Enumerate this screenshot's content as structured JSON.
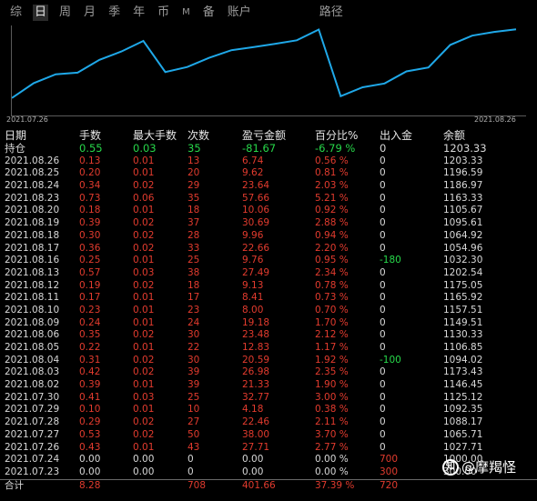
{
  "tabs": [
    {
      "label": "综",
      "active": false
    },
    {
      "label": "日",
      "active": true
    },
    {
      "label": "周",
      "active": false
    },
    {
      "label": "月",
      "active": false
    },
    {
      "label": "季",
      "active": false
    },
    {
      "label": "年",
      "active": false
    },
    {
      "label": "币",
      "active": false
    },
    {
      "label": "M",
      "active": false
    },
    {
      "label": "备",
      "active": false
    },
    {
      "label": "账户",
      "active": false
    },
    {
      "label": "路径",
      "active": false
    }
  ],
  "chart": {
    "start_date": "2021.07.26",
    "end_date": "2021.08.26",
    "line_color": "#1fa8e8"
  },
  "headers": [
    "日期",
    "手数",
    "最大手数",
    "次数",
    "盈亏金额",
    "百分比%",
    "出入金",
    "余额"
  ],
  "holding": {
    "label": "持仓",
    "lots": "0.55",
    "max_lots": "0.03",
    "count": "35",
    "pnl": "-81.67",
    "pct": "-6.79 %",
    "flow": "0",
    "balance": "1203.33"
  },
  "rows": [
    {
      "date": "2021.08.26",
      "lots": "0.13",
      "max": "0.01",
      "count": "13",
      "pnl": "6.74",
      "pct": "0.56 %",
      "flow": "0",
      "balance": "1203.33",
      "flow_color": "white"
    },
    {
      "date": "2021.08.25",
      "lots": "0.20",
      "max": "0.01",
      "count": "20",
      "pnl": "9.62",
      "pct": "0.81 %",
      "flow": "0",
      "balance": "1196.59",
      "flow_color": "white"
    },
    {
      "date": "2021.08.24",
      "lots": "0.34",
      "max": "0.02",
      "count": "29",
      "pnl": "23.64",
      "pct": "2.03 %",
      "flow": "0",
      "balance": "1186.97",
      "flow_color": "white"
    },
    {
      "date": "2021.08.23",
      "lots": "0.73",
      "max": "0.06",
      "count": "35",
      "pnl": "57.66",
      "pct": "5.21 %",
      "flow": "0",
      "balance": "1163.33",
      "flow_color": "white"
    },
    {
      "date": "2021.08.20",
      "lots": "0.18",
      "max": "0.01",
      "count": "18",
      "pnl": "10.06",
      "pct": "0.92 %",
      "flow": "0",
      "balance": "1105.67",
      "flow_color": "white"
    },
    {
      "date": "2021.08.19",
      "lots": "0.39",
      "max": "0.02",
      "count": "37",
      "pnl": "30.69",
      "pct": "2.88 %",
      "flow": "0",
      "balance": "1095.61",
      "flow_color": "white"
    },
    {
      "date": "2021.08.18",
      "lots": "0.30",
      "max": "0.02",
      "count": "28",
      "pnl": "9.96",
      "pct": "0.94 %",
      "flow": "0",
      "balance": "1064.92",
      "flow_color": "white"
    },
    {
      "date": "2021.08.17",
      "lots": "0.36",
      "max": "0.02",
      "count": "33",
      "pnl": "22.66",
      "pct": "2.20 %",
      "flow": "0",
      "balance": "1054.96",
      "flow_color": "white"
    },
    {
      "date": "2021.08.16",
      "lots": "0.25",
      "max": "0.01",
      "count": "25",
      "pnl": "9.76",
      "pct": "0.95 %",
      "flow": "-180",
      "balance": "1032.30",
      "flow_color": "green"
    },
    {
      "date": "2021.08.13",
      "lots": "0.57",
      "max": "0.03",
      "count": "38",
      "pnl": "27.49",
      "pct": "2.34 %",
      "flow": "0",
      "balance": "1202.54",
      "flow_color": "white"
    },
    {
      "date": "2021.08.12",
      "lots": "0.19",
      "max": "0.02",
      "count": "18",
      "pnl": "9.13",
      "pct": "0.78 %",
      "flow": "0",
      "balance": "1175.05",
      "flow_color": "white"
    },
    {
      "date": "2021.08.11",
      "lots": "0.17",
      "max": "0.01",
      "count": "17",
      "pnl": "8.41",
      "pct": "0.73 %",
      "flow": "0",
      "balance": "1165.92",
      "flow_color": "white"
    },
    {
      "date": "2021.08.10",
      "lots": "0.23",
      "max": "0.01",
      "count": "23",
      "pnl": "8.00",
      "pct": "0.70 %",
      "flow": "0",
      "balance": "1157.51",
      "flow_color": "white"
    },
    {
      "date": "2021.08.09",
      "lots": "0.24",
      "max": "0.01",
      "count": "24",
      "pnl": "19.18",
      "pct": "1.70 %",
      "flow": "0",
      "balance": "1149.51",
      "flow_color": "white"
    },
    {
      "date": "2021.08.06",
      "lots": "0.35",
      "max": "0.02",
      "count": "30",
      "pnl": "23.48",
      "pct": "2.12 %",
      "flow": "0",
      "balance": "1130.33",
      "flow_color": "white"
    },
    {
      "date": "2021.08.05",
      "lots": "0.22",
      "max": "0.01",
      "count": "22",
      "pnl": "12.83",
      "pct": "1.17 %",
      "flow": "0",
      "balance": "1106.85",
      "flow_color": "white"
    },
    {
      "date": "2021.08.04",
      "lots": "0.31",
      "max": "0.02",
      "count": "30",
      "pnl": "20.59",
      "pct": "1.92 %",
      "flow": "-100",
      "balance": "1094.02",
      "flow_color": "green"
    },
    {
      "date": "2021.08.03",
      "lots": "0.42",
      "max": "0.02",
      "count": "39",
      "pnl": "26.98",
      "pct": "2.35 %",
      "flow": "0",
      "balance": "1173.43",
      "flow_color": "white"
    },
    {
      "date": "2021.08.02",
      "lots": "0.39",
      "max": "0.01",
      "count": "39",
      "pnl": "21.33",
      "pct": "1.90 %",
      "flow": "0",
      "balance": "1146.45",
      "flow_color": "white"
    },
    {
      "date": "2021.07.30",
      "lots": "0.41",
      "max": "0.03",
      "count": "25",
      "pnl": "32.77",
      "pct": "3.00 %",
      "flow": "0",
      "balance": "1125.12",
      "flow_color": "white"
    },
    {
      "date": "2021.07.29",
      "lots": "0.10",
      "max": "0.01",
      "count": "10",
      "pnl": "4.18",
      "pct": "0.38 %",
      "flow": "0",
      "balance": "1092.35",
      "flow_color": "white"
    },
    {
      "date": "2021.07.28",
      "lots": "0.29",
      "max": "0.02",
      "count": "27",
      "pnl": "22.46",
      "pct": "2.11 %",
      "flow": "0",
      "balance": "1088.17",
      "flow_color": "white"
    },
    {
      "date": "2021.07.27",
      "lots": "0.53",
      "max": "0.02",
      "count": "50",
      "pnl": "38.00",
      "pct": "3.70 %",
      "flow": "0",
      "balance": "1065.71",
      "flow_color": "white"
    },
    {
      "date": "2021.07.26",
      "lots": "0.43",
      "max": "0.01",
      "count": "43",
      "pnl": "27.71",
      "pct": "2.77 %",
      "flow": "0",
      "balance": "1027.71",
      "flow_color": "white"
    }
  ],
  "plain_rows": [
    {
      "date": "2021.07.24",
      "lots": "0.00",
      "max": "0.00",
      "count": "0",
      "pnl": "0.00",
      "pct": "0.00 %",
      "flow": "700",
      "balance": "1000.00"
    },
    {
      "date": "2021.07.23",
      "lots": "0.00",
      "max": "0.00",
      "count": "0",
      "pnl": "0.00",
      "pct": "0.00 %",
      "flow": "300",
      "balance": "300.00"
    }
  ],
  "total": {
    "label": "合计",
    "lots": "8.28",
    "count": "708",
    "pnl": "401.66",
    "pct": "37.39 %",
    "flow": "720"
  },
  "watermark": {
    "icon": "知",
    "text": "@摩羯怪"
  }
}
